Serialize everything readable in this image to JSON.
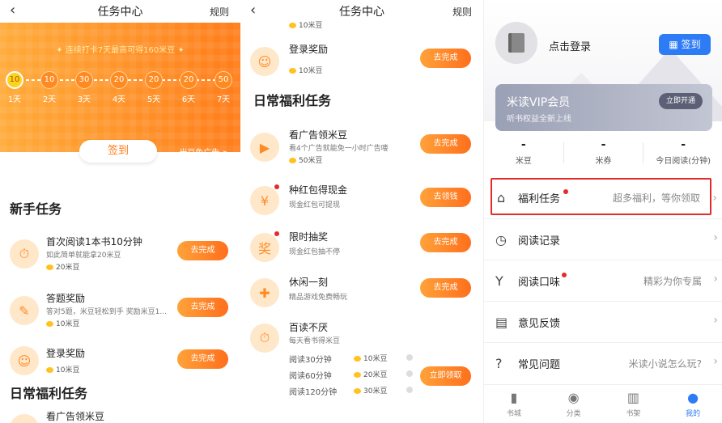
{
  "left": {
    "title": "任务中心",
    "rules": "规则",
    "streak_text": "✦ 连续打卡7天最高可得160米豆 ✦",
    "days": [
      {
        "value": "10",
        "label": "1天"
      },
      {
        "value": "10",
        "label": "2天"
      },
      {
        "value": "30",
        "label": "3天"
      },
      {
        "value": "20",
        "label": "4天"
      },
      {
        "value": "20",
        "label": "5天"
      },
      {
        "value": "20",
        "label": "6天"
      },
      {
        "value": "50",
        "label": "7天"
      }
    ],
    "sign_btn": "签到",
    "free_ad": "米豆免广告 >",
    "newbie_title": "新手任务",
    "tasks": [
      {
        "title": "首次阅读1本书10分钟",
        "desc": "如此简单就能拿20米豆",
        "reward": "20米豆",
        "btn": "去完成",
        "icon": "stopwatch-icon"
      },
      {
        "title": "答题奖励",
        "desc": "答对5题，米豆轻松到手 奖励米豆1...",
        "reward": "10米豆",
        "btn": "去完成",
        "icon": "quiz-icon"
      },
      {
        "title": "登录奖励",
        "desc": "",
        "reward": "10米豆",
        "btn": "去完成",
        "icon": "user-icon"
      }
    ],
    "daily_title": "日常福利任务",
    "cut_task": "看广告领米豆"
  },
  "middle": {
    "title": "任务中心",
    "rules": "规则",
    "top_reward": "10米豆",
    "login": {
      "title": "登录奖励",
      "reward": "10米豆",
      "btn": "去完成"
    },
    "daily_title": "日常福利任务",
    "tasks": [
      {
        "title": "看广告领米豆",
        "desc": "看4个广告就能免一小时广告喽",
        "reward": "50米豆",
        "btn": "去完成"
      },
      {
        "title": "种红包得现金",
        "desc": "现金红包可提现",
        "btn": "去领钱"
      },
      {
        "title": "限时抽奖",
        "desc": "现金红包抽不停",
        "btn": "去完成"
      },
      {
        "title": "休闲一刻",
        "desc": "精品游戏免费畅玩",
        "btn": "去完成"
      }
    ],
    "reading": {
      "title": "百读不厌",
      "desc": "每天看书得米豆",
      "steps": [
        {
          "label": "阅读30分钟",
          "reward": "10米豆"
        },
        {
          "label": "阅读60分钟",
          "reward": "20米豆"
        },
        {
          "label": "阅读120分钟",
          "reward": "30米豆"
        }
      ],
      "btn": "立即领取"
    }
  },
  "right": {
    "login_text": "点击登录",
    "checkin": "签到",
    "vip": {
      "title": "米读VIP会员",
      "subtitle": "听书权益全新上线",
      "btn": "立即开通"
    },
    "stats": [
      {
        "value": "-",
        "label": "米豆"
      },
      {
        "value": "-",
        "label": "米券"
      },
      {
        "value": "-",
        "label": "今日阅读(分钟)"
      }
    ],
    "menu": [
      {
        "label": "福利任务",
        "right": "超多福利，等你领取",
        "icon": "gift-icon"
      },
      {
        "label": "阅读记录",
        "right": "",
        "icon": "clock-icon"
      },
      {
        "label": "阅读口味",
        "right": "精彩为你专属",
        "icon": "taste-icon"
      },
      {
        "label": "意见反馈",
        "right": "",
        "icon": "feedback-icon"
      },
      {
        "label": "常见问题",
        "right": "米读小说怎么玩?",
        "icon": "help-icon"
      }
    ],
    "tabs": [
      {
        "label": "书城"
      },
      {
        "label": "分类"
      },
      {
        "label": "书架"
      },
      {
        "label": "我的"
      }
    ]
  }
}
